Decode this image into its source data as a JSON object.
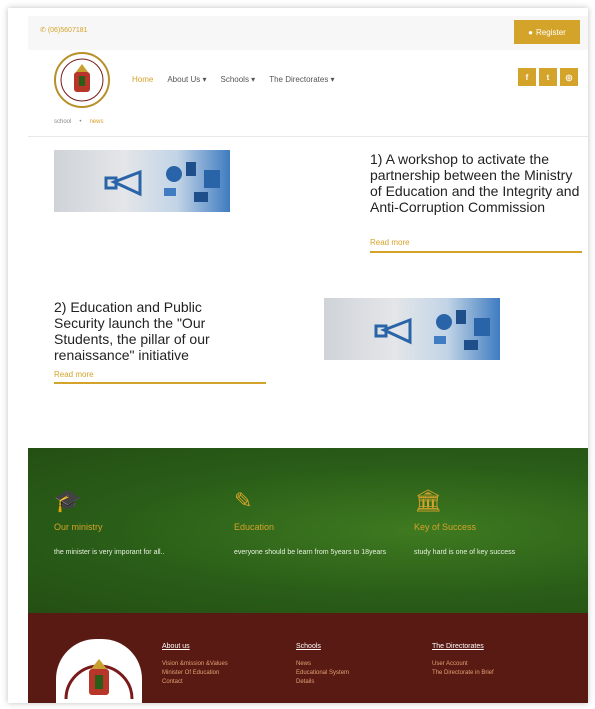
{
  "topbar": {
    "phone": "(06)5607181",
    "register_label": "Register"
  },
  "nav": {
    "items": [
      "Home",
      "About Us ▾",
      "Schools ▾",
      "The Directorates ▾"
    ]
  },
  "social": [
    "f",
    "t",
    "◎"
  ],
  "breadcrumb": {
    "home": "school",
    "current": "news"
  },
  "news": [
    {
      "title": "1) A workshop to activate the partnership between the Ministry of Education and the Integrity and Anti-Corruption Commission",
      "read_more": "Read more"
    },
    {
      "title": "2) Education and Public Security launch the \"Our Students, the pillar of our renaissance\" initiative",
      "read_more": "Read more"
    }
  ],
  "features": [
    {
      "icon": "graduation-cap-icon",
      "heading": "Our ministry",
      "text": "the minister is very imporant for all.."
    },
    {
      "icon": "ruler-pencil-icon",
      "heading": "Education",
      "text": "everyone should be learn from 5years to 18years"
    },
    {
      "icon": "building-icon",
      "heading": "Key of Success",
      "text": "study hard is one of key success"
    }
  ],
  "footer": {
    "columns": [
      {
        "heading": "About us",
        "links": [
          "Vision &mission &Values",
          "Minister Of Education",
          "Contact"
        ]
      },
      {
        "heading": "Schools",
        "links": [
          "News",
          "Educational System",
          "Details"
        ]
      },
      {
        "heading": "The Directorates",
        "links": [
          "User Account",
          "The Directorate in Brief"
        ]
      }
    ]
  },
  "colors": {
    "accent": "#d4a32a",
    "green": "#2a5e18",
    "footer": "#5a1a14"
  }
}
